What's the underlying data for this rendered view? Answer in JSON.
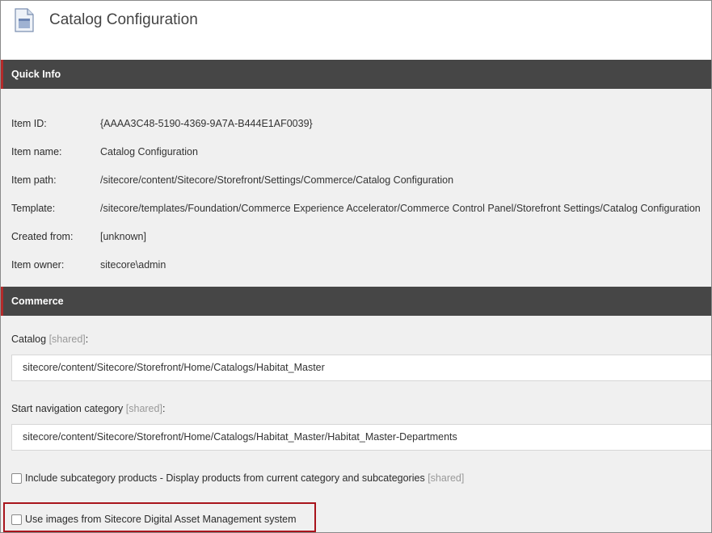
{
  "page": {
    "title": "Catalog Configuration",
    "icon": "document-icon"
  },
  "quick_info": {
    "heading": "Quick Info",
    "rows": [
      {
        "label": "Item ID:",
        "value": "{AAAA3C48-5190-4369-9A7A-B444E1AF0039}"
      },
      {
        "label": "Item name:",
        "value": "Catalog Configuration"
      },
      {
        "label": "Item path:",
        "value": "/sitecore/content/Sitecore/Storefront/Settings/Commerce/Catalog Configuration"
      },
      {
        "label": "Template:",
        "value": "/sitecore/templates/Foundation/Commerce Experience Accelerator/Commerce Control Panel/Storefront Settings/Catalog Configuration"
      },
      {
        "label": "Created from:",
        "value": "[unknown]"
      },
      {
        "label": "Item owner:",
        "value": "sitecore\\admin"
      }
    ]
  },
  "commerce": {
    "heading": "Commerce",
    "catalog": {
      "label": "Catalog",
      "shared": "[shared]",
      "colon": ":",
      "value": "sitecore/content/Sitecore/Storefront/Home/Catalogs/Habitat_Master"
    },
    "start_nav": {
      "label": "Start navigation category",
      "shared": "[shared]",
      "colon": ":",
      "value": "sitecore/content/Sitecore/Storefront/Home/Catalogs/Habitat_Master/Habitat_Master-Departments"
    },
    "include_subcategory": {
      "label": "Include subcategory products - Display products from current category and subcategories",
      "shared": "[shared]",
      "checked": false
    },
    "use_dam_images": {
      "label": "Use images from Sitecore Digital Asset Management system",
      "checked": false
    }
  },
  "colors": {
    "section_bar": "#464646",
    "accent_red": "#b22a2a",
    "highlight": "#a8141c"
  }
}
